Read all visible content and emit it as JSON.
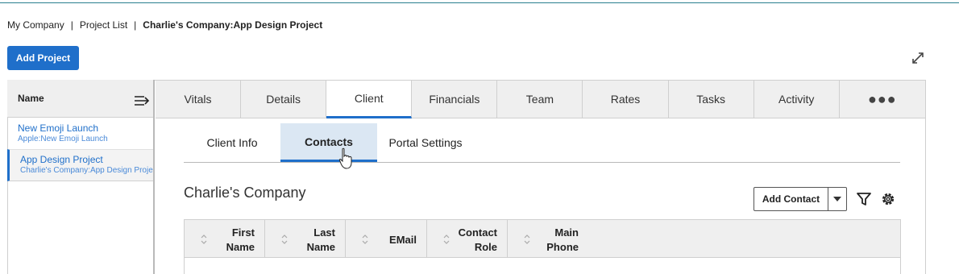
{
  "breadcrumb": {
    "items": [
      "My Company",
      "Project List"
    ],
    "separator": "|",
    "current": "Charlie's Company:App Design Project"
  },
  "toolbar": {
    "add_project_label": "Add Project"
  },
  "project_list": {
    "header": "Name",
    "items": [
      {
        "name": "New Emoji Launch",
        "sub": "Apple:New Emoji Launch",
        "selected": false
      },
      {
        "name": "App Design Project",
        "sub": "Charlie's Company:App Design Project",
        "selected": true
      }
    ]
  },
  "tabs": [
    "Vitals",
    "Details",
    "Client",
    "Financials",
    "Team",
    "Rates",
    "Tasks",
    "Activity",
    "●●●"
  ],
  "active_tab": "Client",
  "subtabs": [
    "Client Info",
    "Contacts",
    "Portal Settings"
  ],
  "active_subtab": "Contacts",
  "client": {
    "company_name": "Charlie's Company"
  },
  "contacts": {
    "add_label": "Add Contact",
    "columns": [
      "First\nName",
      "Last\nName",
      "EMail",
      "Contact\nRole",
      "Main\nPhone"
    ],
    "rows": []
  },
  "colors": {
    "accent": "#1f6fca",
    "tab_bg": "#efefef",
    "subtab_active_bg": "#dbe7f3"
  },
  "icons": [
    "expand-icon",
    "collapse-panel-icon",
    "sort-icon",
    "caret-down-icon",
    "filter-icon",
    "gear-icon",
    "hand-cursor-icon"
  ]
}
